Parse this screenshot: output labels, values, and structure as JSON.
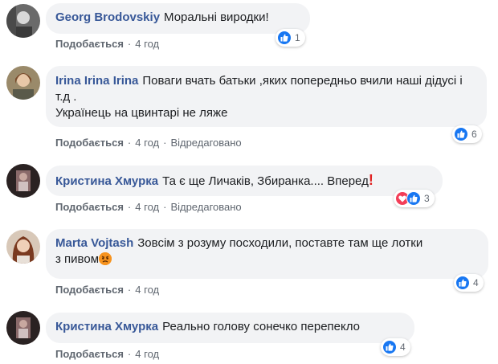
{
  "comments": [
    {
      "author": "Georg Brodovskiy",
      "text": "Моральні виродки!",
      "like_label": "Подобається",
      "time": "4 год",
      "edited": "",
      "reaction_count": "1"
    },
    {
      "author": "Irina Irina Irina",
      "text": "Поваги вчать батьки ,яких попередньо вчили наші дідусі і т.д .",
      "text2": "Українець на цвинтарі не ляже",
      "like_label": "Подобається",
      "time": "4 год",
      "edited": "Відредаговано",
      "reaction_count": "6"
    },
    {
      "author": "Кристина Хмурка",
      "text": "Та є ще Личаків, Збиранка.... Вперед",
      "like_label": "Подобається",
      "time": "4 год",
      "edited": "Відредаговано",
      "reaction_count": "3"
    },
    {
      "author": "Marta Vojtash",
      "text": "Зовсім з розуму посходили, поставте там ще лотки",
      "text2": "з пивом",
      "like_label": "Подобається",
      "time": "4 год",
      "edited": "",
      "reaction_count": "4"
    },
    {
      "author": "Кристина Хмурка",
      "text": "Реально голову сонечко перепекло",
      "like_label": "Подобається",
      "time": "4 год",
      "edited": "",
      "reaction_count": "4"
    }
  ],
  "separator": "·",
  "colors": {
    "author": "#385898",
    "bubble": "#f2f3f5",
    "like_reaction": "#1877f2",
    "love_reaction": "#f33e58"
  }
}
